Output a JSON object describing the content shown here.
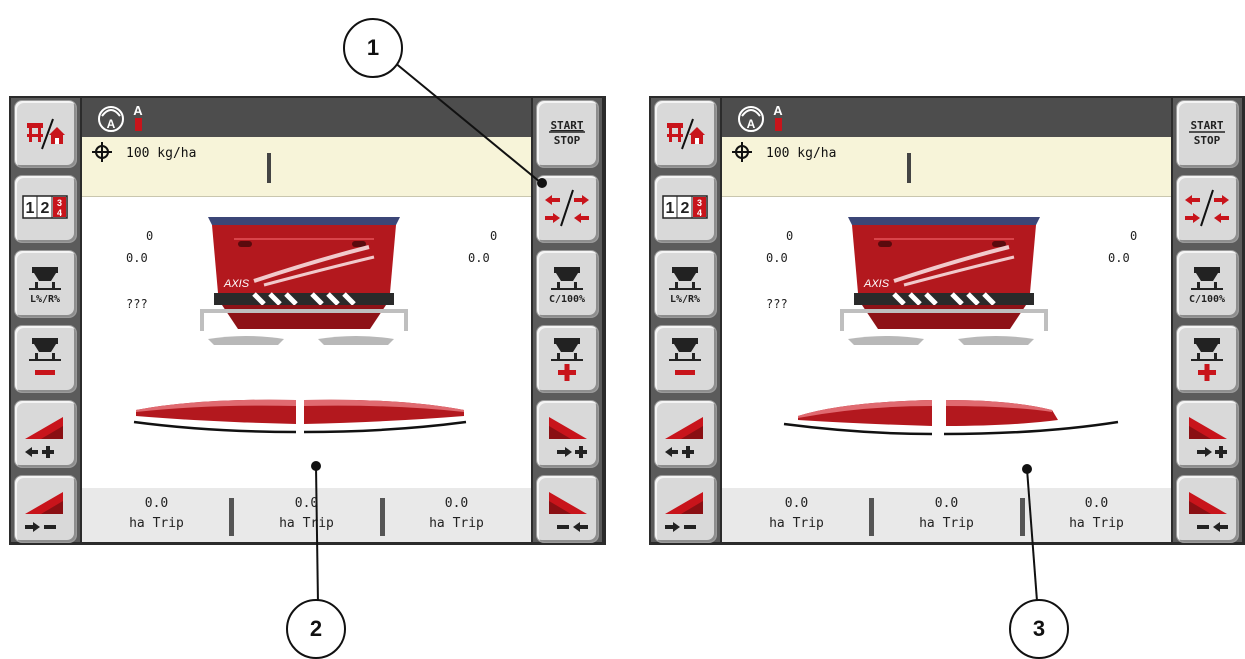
{
  "screens": [
    {
      "rate": "100 kg/ha",
      "left_count": "0",
      "left_flow": "0.0",
      "left_unknown": "???",
      "right_count": "0",
      "right_flow": "0.0",
      "machine_label": "AXIS",
      "trips": [
        {
          "value": "0.0",
          "label": "ha Trip"
        },
        {
          "value": "0.0",
          "label": "ha Trip"
        },
        {
          "value": "0.0",
          "label": "ha Trip"
        }
      ],
      "left_buttons": [
        "machine-home-icon",
        "digits-1234-icon",
        "lr-percent-icon",
        "minus-icon",
        "increase-left-icon",
        "decrease-left-icon"
      ],
      "right_buttons": [
        "start-stop-icon",
        "arrows-swap-icon",
        "c-100-percent-icon",
        "plus-icon",
        "increase-right-icon",
        "decrease-right-icon"
      ],
      "start_label": "START",
      "stop_label": "STOP",
      "lr_label": "L%/R%",
      "c100_label": "C/100%",
      "digits": [
        "1",
        "2",
        "3",
        "4"
      ]
    },
    {
      "rate": "100 kg/ha",
      "left_count": "0",
      "left_flow": "0.0",
      "left_unknown": "???",
      "right_count": "0",
      "right_flow": "0.0",
      "machine_label": "AXIS",
      "trips": [
        {
          "value": "0.0",
          "label": "ha Trip"
        },
        {
          "value": "0.0",
          "label": "ha Trip"
        },
        {
          "value": "0.0",
          "label": "ha Trip"
        }
      ],
      "start_label": "START",
      "stop_label": "STOP",
      "lr_label": "L%/R%",
      "c100_label": "C/100%",
      "digits": [
        "1",
        "2",
        "3",
        "4"
      ]
    }
  ],
  "callouts": [
    "1",
    "2",
    "3"
  ],
  "colors": {
    "machine_red": "#b3181e",
    "panel_gray": "#5b5b5b",
    "info_yellow": "#f7f4d9",
    "accent_red": "#c8141b"
  }
}
